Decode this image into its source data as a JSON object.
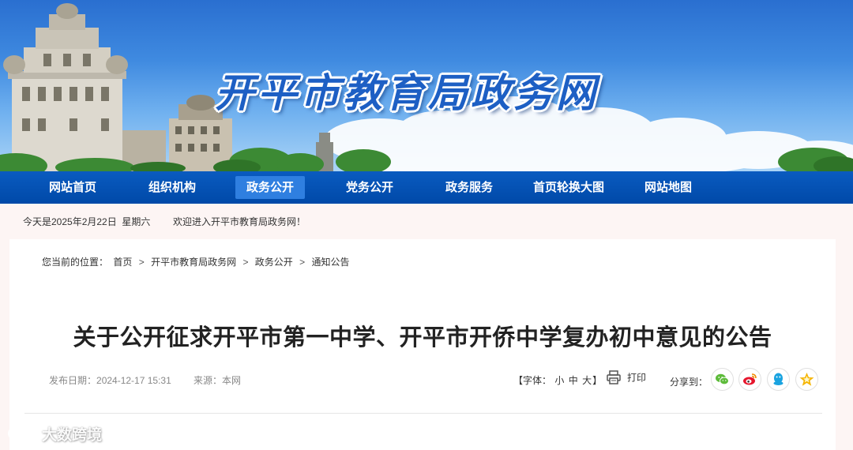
{
  "site": {
    "title": "开平市教育局政务网"
  },
  "nav": {
    "items": [
      {
        "label": "网站首页"
      },
      {
        "label": "组织机构"
      },
      {
        "label": "政务公开"
      },
      {
        "label": "党务公开"
      },
      {
        "label": "政务服务"
      },
      {
        "label": "首页轮换大图"
      },
      {
        "label": "网站地图"
      }
    ],
    "active": "政务公开"
  },
  "topbar": {
    "date": "今天是2025年2月22日  星期六",
    "welcome": "欢迎进入开平市教育局政务网！"
  },
  "breadcrumb": {
    "prefix": "您当前的位置：",
    "items": [
      "首页",
      "开平市教育局政务网",
      "政务公开",
      "通知公告"
    ],
    "separator": ">"
  },
  "article": {
    "title": "关于公开征求开平市第一中学、开平市开侨中学复办初中意见的公告",
    "publish_label": "发布日期：",
    "publish_date": "2024-12-17 15:31",
    "source_label": "来源：",
    "source": "本网"
  },
  "toolbar": {
    "font_open": "【字体：",
    "font_small": "小",
    "font_medium": "中",
    "font_large": "大",
    "font_close": "】",
    "print_label": "打印",
    "share_label": "分享到："
  },
  "share": {
    "items": [
      "wechat-icon",
      "weibo-icon",
      "qq-icon",
      "qzone-icon"
    ],
    "colors": {
      "wechat": "#5dbb3a",
      "weibo": "#e6162d",
      "qq": "#1aa3e0",
      "qzone": "#f5b400"
    }
  },
  "colors": {
    "nav_bg": "#0049a8",
    "nav_active": "#2f7fe0",
    "title_blue": "#1d5fc4"
  },
  "watermark": {
    "text": "大数跨境"
  }
}
